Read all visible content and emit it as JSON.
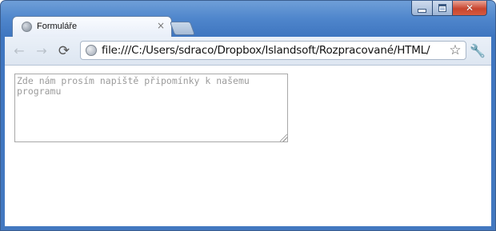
{
  "tab": {
    "title": "Formuláře",
    "close": "×"
  },
  "window_controls": {
    "minimize": "",
    "maximize": "",
    "close": "✕"
  },
  "toolbar": {
    "back": "←",
    "forward": "→",
    "reload": "⟳",
    "url": "file:///C:/Users/sdraco/Dropbox/Islandsoft/Rozpracované/HTML/",
    "star": "☆",
    "wrench": "🔧"
  },
  "form": {
    "comment": {
      "value": "",
      "placeholder": "Zde nám prosím napiště připomínky k našemu programu"
    }
  },
  "icons": {
    "tab_favicon": "globe-icon",
    "page": "page-icon",
    "star": "star-icon",
    "wrench": "wrench-icon"
  }
}
